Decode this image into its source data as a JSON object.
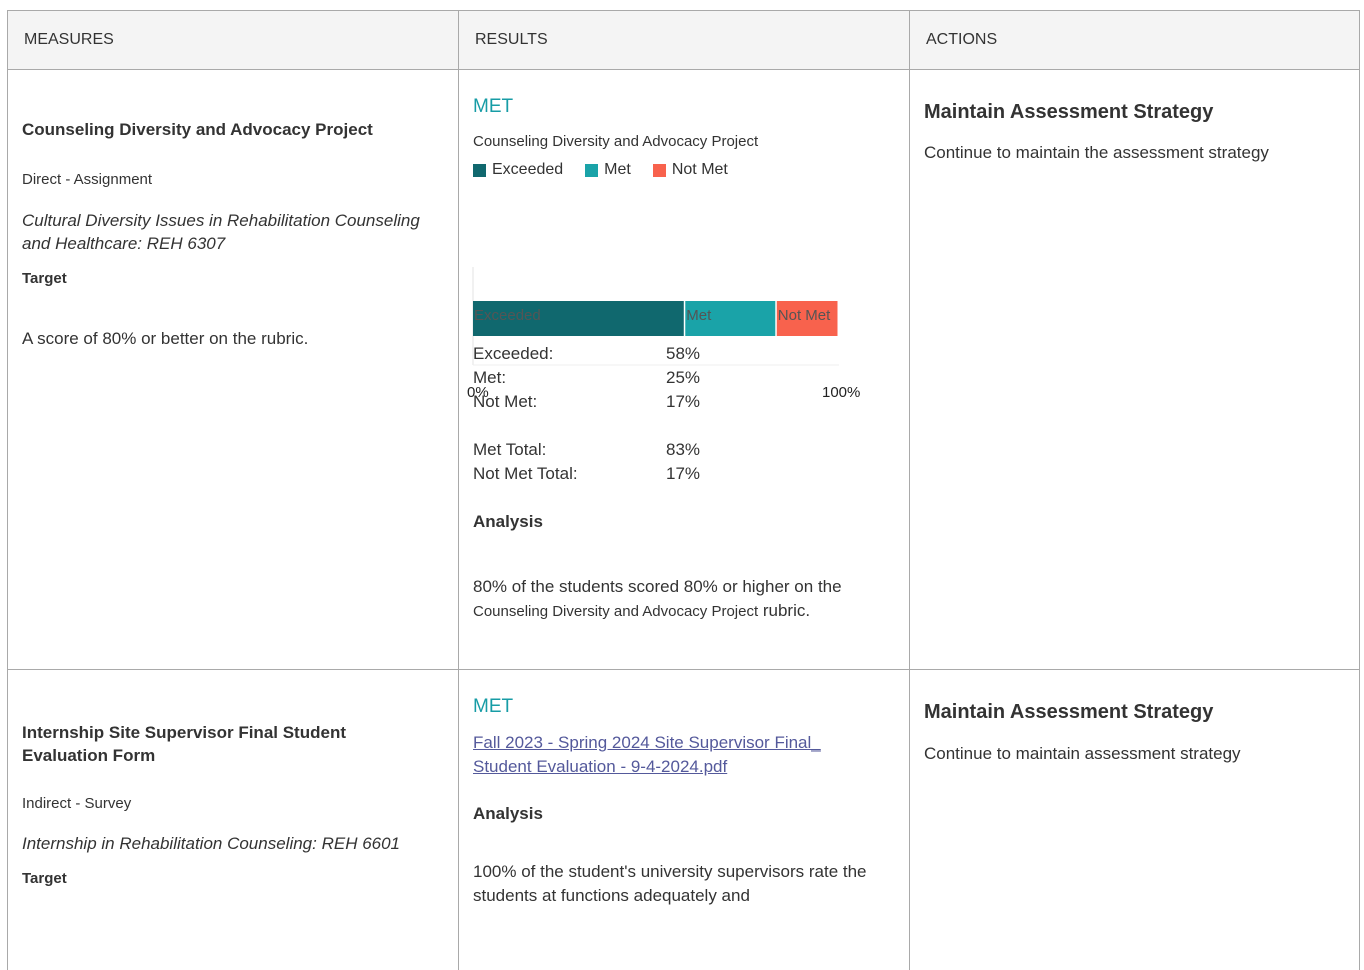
{
  "headers": [
    "MEASURES",
    "RESULTS",
    "ACTIONS"
  ],
  "rows": [
    {
      "measure": {
        "title": "Counseling Diversity and Advocacy Project",
        "type": "Direct - Assignment",
        "course": "Cultural Diversity Issues in Rehabilitation Counseling and Healthcare: REH 6307",
        "target_label": "Target",
        "target_text": "A score of 80% or better on the rubric."
      },
      "result": {
        "status": "MET",
        "chart_title": "Counseling Diversity and Advocacy Project",
        "legend": [
          {
            "label": "Exceeded",
            "color": "#10686e"
          },
          {
            "label": "Met",
            "color": "#1aa3a8"
          },
          {
            "label": "Not Met",
            "color": "#f8624d"
          }
        ],
        "stats": [
          {
            "label": "Exceeded:",
            "value": "58%"
          },
          {
            "label": "Met:",
            "value": "25%"
          },
          {
            "label": "Not Met:",
            "value": "17%"
          }
        ],
        "totals": [
          {
            "label": "Met Total:",
            "value": "83%"
          },
          {
            "label": "Not Met Total:",
            "value": "17%"
          }
        ],
        "analysis_heading": "Analysis",
        "analysis_part1": "80% of the students scored 80% or higher on the ",
        "analysis_part2": "Counseling Diversity and Advocacy Project",
        "analysis_part3": " rubric."
      },
      "action": {
        "title": "Maintain Assessment Strategy",
        "text": "Continue to maintain the assessment strategy"
      }
    },
    {
      "measure": {
        "title": "Internship Site Supervisor Final Student Evaluation Form",
        "type": "Indirect - Survey",
        "course": "Internship in Rehabilitation Counseling: REH 6601",
        "target_label": "Target"
      },
      "result": {
        "status": "MET",
        "link": "Fall 2023 - Spring 2024 Site Supervisor Final_ Student Evaluation - 9-4-2024.pdf",
        "analysis_heading": "Analysis",
        "analysis": "100% of the student's university supervisors rate the students at functions adequately and"
      },
      "action": {
        "title": "Maintain Assessment Strategy",
        "text": "Continue to maintain assessment strategy"
      }
    }
  ],
  "chart_data": {
    "type": "bar",
    "orientation": "horizontal-stacked",
    "categories": [
      "Counseling Diversity and Advocacy Project"
    ],
    "series": [
      {
        "name": "Exceeded",
        "values": [
          58
        ]
      },
      {
        "name": "Met",
        "values": [
          25
        ]
      },
      {
        "name": "Not Met",
        "values": [
          17
        ]
      }
    ],
    "xlim": [
      0,
      100
    ],
    "tick_labels": [
      "0%",
      "100%"
    ],
    "bar_labels": [
      "Exceeded",
      "Met",
      "Not Met"
    ],
    "legend_position": "top-left"
  }
}
